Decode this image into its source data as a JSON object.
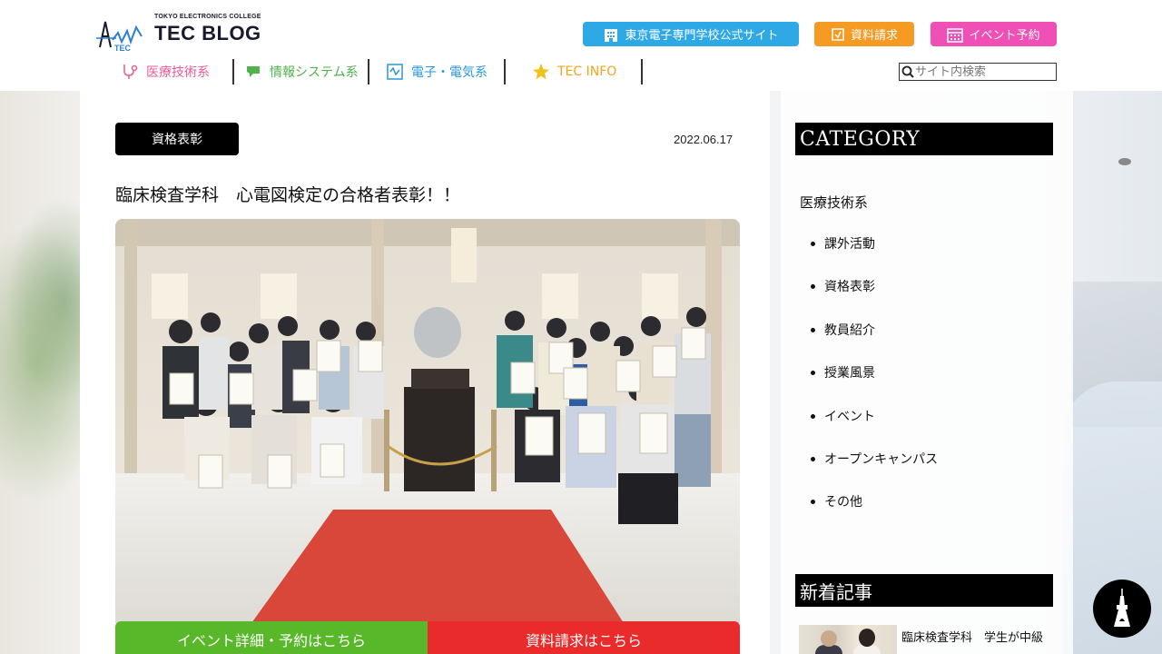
{
  "header": {
    "logo": {
      "subtitle": "TOKYO ELECTRONICS COLLEGE",
      "title": "TEC BLOG",
      "mark_text": "TEC"
    },
    "buttons": {
      "official": "東京電子専門学校公式サイト",
      "request": "資料請求",
      "event": "イベント予約"
    },
    "nav": {
      "medical": "医療技術系",
      "info": "情報システム系",
      "elec": "電子・電気系",
      "tec": "TEC INFO"
    },
    "search": {
      "placeholder": "サイト内検索"
    },
    "colors": {
      "official": "#2fa8e6",
      "request": "#f59a22",
      "event": "#f04fb6",
      "medical": "#e85a9a",
      "info": "#4fb24a",
      "elec": "#2b97d6",
      "tec": "#f2a61c"
    }
  },
  "post": {
    "category_badge": "資格表彰",
    "date": "2022.06.17",
    "title": "臨床検査学科　心電図検定の合格者表彰！！",
    "photo_caption_icon": "group-photo",
    "cta_event": "イベント詳細・予約はこちら",
    "cta_request": "資料請求はこちら"
  },
  "sidebar": {
    "category_heading": "CATEGORY",
    "parent": "医療技術系",
    "items": [
      "課外活動",
      "資格表彰",
      "教員紹介",
      "授業風景",
      "イベント",
      "オープンキャンパス",
      "その他"
    ],
    "new_heading": "新着記事",
    "new_article_text": "臨床検査学科　学生が中級"
  },
  "floating": {
    "icon": "tower-icon"
  }
}
